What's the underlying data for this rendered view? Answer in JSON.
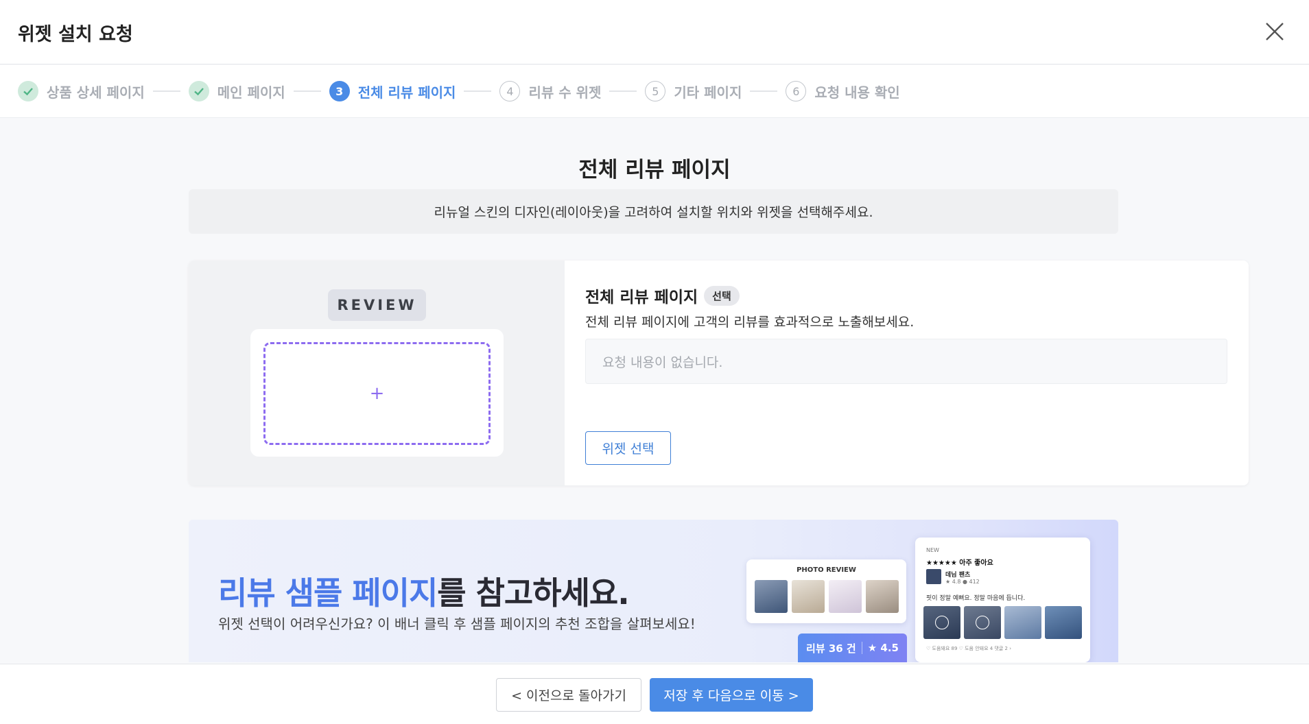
{
  "header": {
    "title": "위젯 설치 요청",
    "close_icon": "close-icon"
  },
  "stepper": {
    "steps": [
      {
        "num": "1",
        "label": "상품 상세 페이지",
        "state": "done"
      },
      {
        "num": "2",
        "label": "메인 페이지",
        "state": "done"
      },
      {
        "num": "3",
        "label": "전체 리뷰 페이지",
        "state": "active"
      },
      {
        "num": "4",
        "label": "리뷰 수 위젯",
        "state": "todo"
      },
      {
        "num": "5",
        "label": "기타 페이지",
        "state": "todo"
      },
      {
        "num": "6",
        "label": "요청 내용 확인",
        "state": "todo"
      }
    ]
  },
  "main": {
    "title": "전체 리뷰 페이지",
    "notice": "리뉴얼 스킨의 디자인(레이아웃)을 고려하여 설치할 위치와 위젯을 선택해주세요."
  },
  "widget": {
    "preview_tag": "REVIEW",
    "preview_plus": "+",
    "title": "전체 리뷰 페이지",
    "badge": "선택",
    "description": "전체 리뷰 페이지에 고객의 리뷰를 효과적으로 노출해보세요.",
    "empty_text": "요청 내용이 없습니다.",
    "select_button": "위젯 선택"
  },
  "banner": {
    "title_highlight": "리뷰 샘플 페이지",
    "title_rest": "를 참고하세요.",
    "subtitle": "위젯 선택이 어려우신가요? 이 배너 클릭 후 샘플 페이지의 추천 조합을 살펴보세요!",
    "mock_photo_header": "PHOTO REVIEW",
    "mock_new": "NEW",
    "mock_stars": "★★★★★ 아주 좋아요",
    "mock_product": "데님 팬츠",
    "mock_meta": "★ 4.8  ● 412",
    "mock_text": "핏이 정말 예뻐요. 정말 마음에 듭니다.",
    "mock_footer": "♡ 도움돼요 89   ♡ 도움 안돼요 4   댓글 2 ›",
    "pill_count": "리뷰 36 건",
    "pill_rating": "★ 4.5",
    "colors": {
      "highlight": "#4b79e8"
    }
  },
  "footer": {
    "prev_button": "< 이전으로 돌아가기",
    "next_button": "저장 후 다음으로 이동 >"
  },
  "colors": {
    "accent": "#4a8be6",
    "done": "#cfeadc",
    "dashed": "#8d6cf0"
  }
}
